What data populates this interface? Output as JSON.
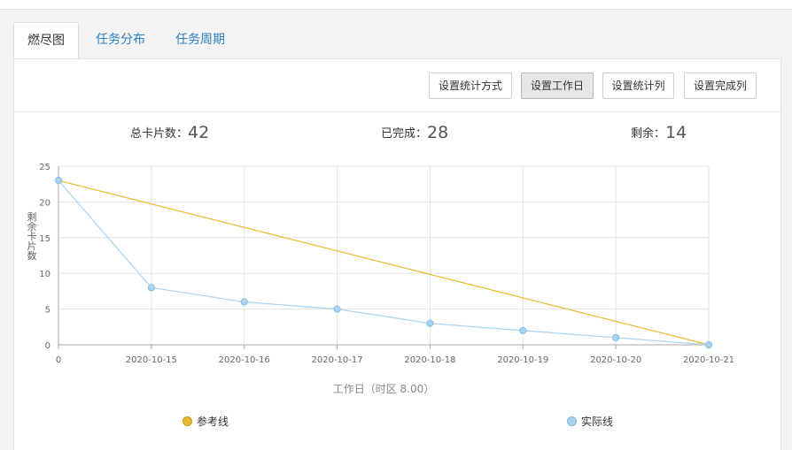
{
  "tabs": [
    {
      "label": "燃尽图",
      "active": true
    },
    {
      "label": "任务分布",
      "active": false
    },
    {
      "label": "任务周期",
      "active": false
    }
  ],
  "toolbar": {
    "buttons": [
      {
        "label": "设置统计方式",
        "active": false
      },
      {
        "label": "设置工作日",
        "active": true
      },
      {
        "label": "设置统计列",
        "active": false
      },
      {
        "label": "设置完成列",
        "active": false
      }
    ]
  },
  "stats": {
    "total_label": "总卡片数：",
    "total_value": "42",
    "done_label": "已完成：",
    "done_value": "28",
    "remaining_label": "剩余：",
    "remaining_value": "14"
  },
  "chart_data": {
    "type": "line",
    "categories": [
      "0",
      "2020-10-15",
      "2020-10-16",
      "2020-10-17",
      "2020-10-18",
      "2020-10-19",
      "2020-10-20",
      "2020-10-21"
    ],
    "ylabel": "剩余卡片数",
    "xlabel": "工作日（时区 8.00）",
    "ylim": [
      0,
      25
    ],
    "yticks": [
      0,
      5,
      10,
      15,
      20,
      25
    ],
    "grid": true,
    "legend_placement": "bottom",
    "series": [
      {
        "name": "参考线",
        "color": "#e8b830",
        "values": [
          23,
          null,
          null,
          null,
          null,
          null,
          null,
          0
        ],
        "markers": false
      },
      {
        "name": "实际线",
        "color": "#a9d3f0",
        "values": [
          23,
          8,
          6,
          5,
          3,
          2,
          1,
          0
        ],
        "markers": true
      }
    ]
  }
}
